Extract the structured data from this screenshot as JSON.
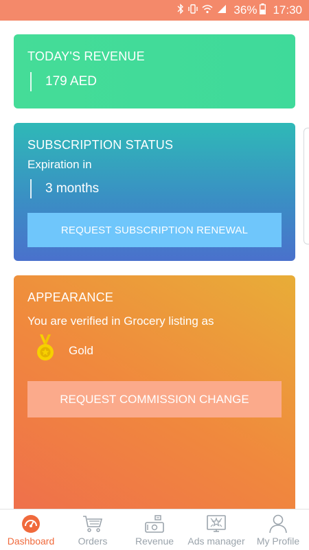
{
  "status_bar": {
    "battery": "36%",
    "time": "17:30",
    "icons": [
      "bluetooth-icon",
      "vibrate-icon",
      "wifi-icon",
      "signal-icon",
      "battery-icon"
    ]
  },
  "revenue": {
    "title": "TODAY'S REVENUE",
    "value": "179 AED"
  },
  "subscription": {
    "title": "SUBSCRIPTION STATUS",
    "subtitle": "Expiration in",
    "value": "3 months",
    "button_label": "REQUEST SUBSCRIPTION RENEWAL"
  },
  "appearance": {
    "title": "APPEARANCE",
    "description": "You are verified in Grocery listing as",
    "tier": "Gold",
    "tier_icon": "gold-medal-icon",
    "button_label": "REQUEST COMMISSION CHANGE"
  },
  "nav": {
    "items": [
      {
        "label": "Dashboard",
        "icon": "dashboard-icon",
        "active": true
      },
      {
        "label": "Orders",
        "icon": "cart-icon",
        "active": false
      },
      {
        "label": "Revenue",
        "icon": "revenue-icon",
        "active": false
      },
      {
        "label": "Ads manager",
        "icon": "ads-icon",
        "active": false
      },
      {
        "label": "My Profile",
        "icon": "profile-icon",
        "active": false
      }
    ]
  },
  "colors": {
    "status_bar": "#f4896a",
    "revenue_card": "#45dc98",
    "subscription_button": "#6fc6fb",
    "commission_button": "#fbaa8b",
    "active_nav": "#f06a3c",
    "inactive_nav": "#9aa3ab"
  }
}
